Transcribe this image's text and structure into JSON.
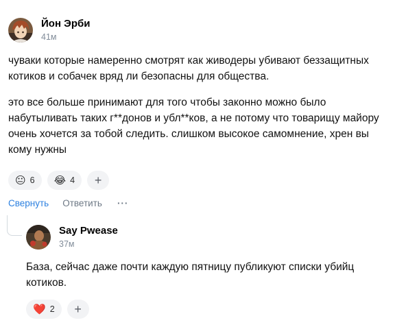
{
  "comment": {
    "author": "Йон Эрби",
    "time": "41м",
    "paragraphs": [
      "чуваки которые намеренно смотрят как живодеры убивают беззащитных котиков и собачек вряд ли безопасны для общества.",
      "это все больше принимают для того чтобы законно можно было набутыливать таких г**донов и убл**ков, а не потому что товарищу майору очень хочется за тобой следить. слишком высокое самомнение, хрен вы кому нужны"
    ],
    "reactions": [
      {
        "emoji": "😐",
        "icon": "neutral-face-icon",
        "count": "6"
      },
      {
        "emoji": "😂",
        "icon": "tears-of-joy-icon",
        "count": "4"
      }
    ],
    "add_reaction": "+",
    "actions": {
      "collapse": "Свернуть",
      "reply": "Ответить",
      "more": "···"
    }
  },
  "reply": {
    "author": "Say Pwease",
    "time": "37м",
    "text": "База, сейчас даже почти каждую пятницу публикуют списки убийц котиков.",
    "reactions": [
      {
        "emoji": "❤️",
        "icon": "heart-icon",
        "count": "2"
      }
    ],
    "add_reaction": "+"
  },
  "colors": {
    "link": "#2d81e0",
    "muted": "#818c99",
    "chip_bg": "#f2f3f5",
    "heart": "#e64646"
  }
}
